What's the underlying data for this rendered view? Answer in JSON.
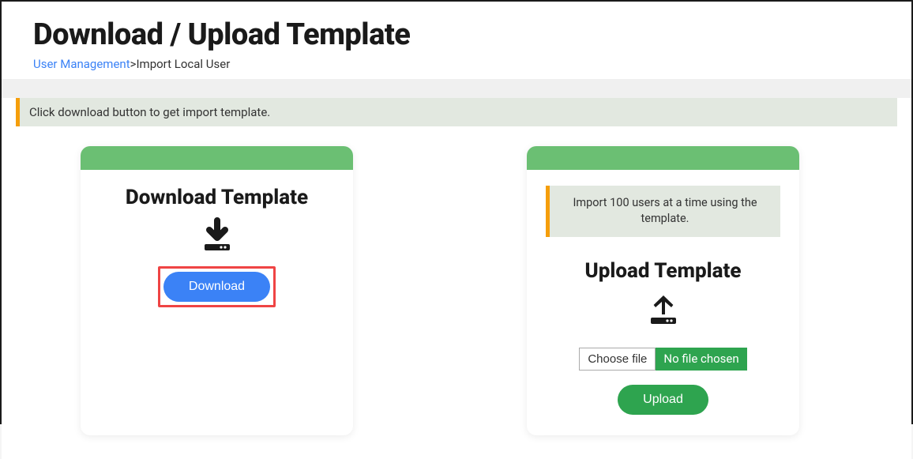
{
  "header": {
    "title": "Download / Upload Template",
    "breadcrumb": {
      "link_label": "User Management",
      "current": "Import Local User"
    }
  },
  "info_banner": "Click download button to get import template.",
  "download_card": {
    "title": "Download Template",
    "button_label": "Download"
  },
  "upload_card": {
    "inner_banner": "Import 100 users at a time using the template.",
    "title": "Upload Template",
    "choose_file_label": "Choose file",
    "file_status": "No file chosen",
    "button_label": "Upload"
  }
}
